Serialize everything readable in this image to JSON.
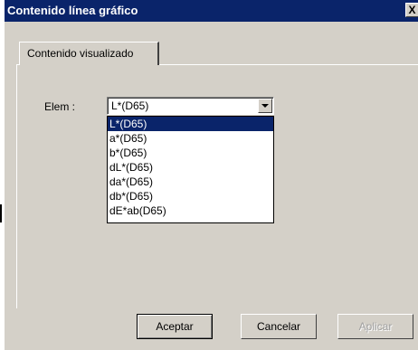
{
  "window": {
    "title": "Contenido línea gráfico",
    "close_label": "X"
  },
  "tabs": [
    {
      "label": "Contenido visualizado",
      "active": true
    }
  ],
  "elem": {
    "label": "Elem :",
    "selected_value": "L*(D65)",
    "options": [
      "L*(D65)",
      "a*(D65)",
      "b*(D65)",
      "dL*(D65)",
      "da*(D65)",
      "db*(D65)",
      "dE*ab(D65)"
    ],
    "highlighted_index": 0
  },
  "buttons": {
    "accept": "Aceptar",
    "cancel": "Cancelar",
    "apply": "Aplicar"
  },
  "colors": {
    "titlebar": "#0a246a",
    "face": "#d4d0c8",
    "selection": "#0a246a"
  }
}
